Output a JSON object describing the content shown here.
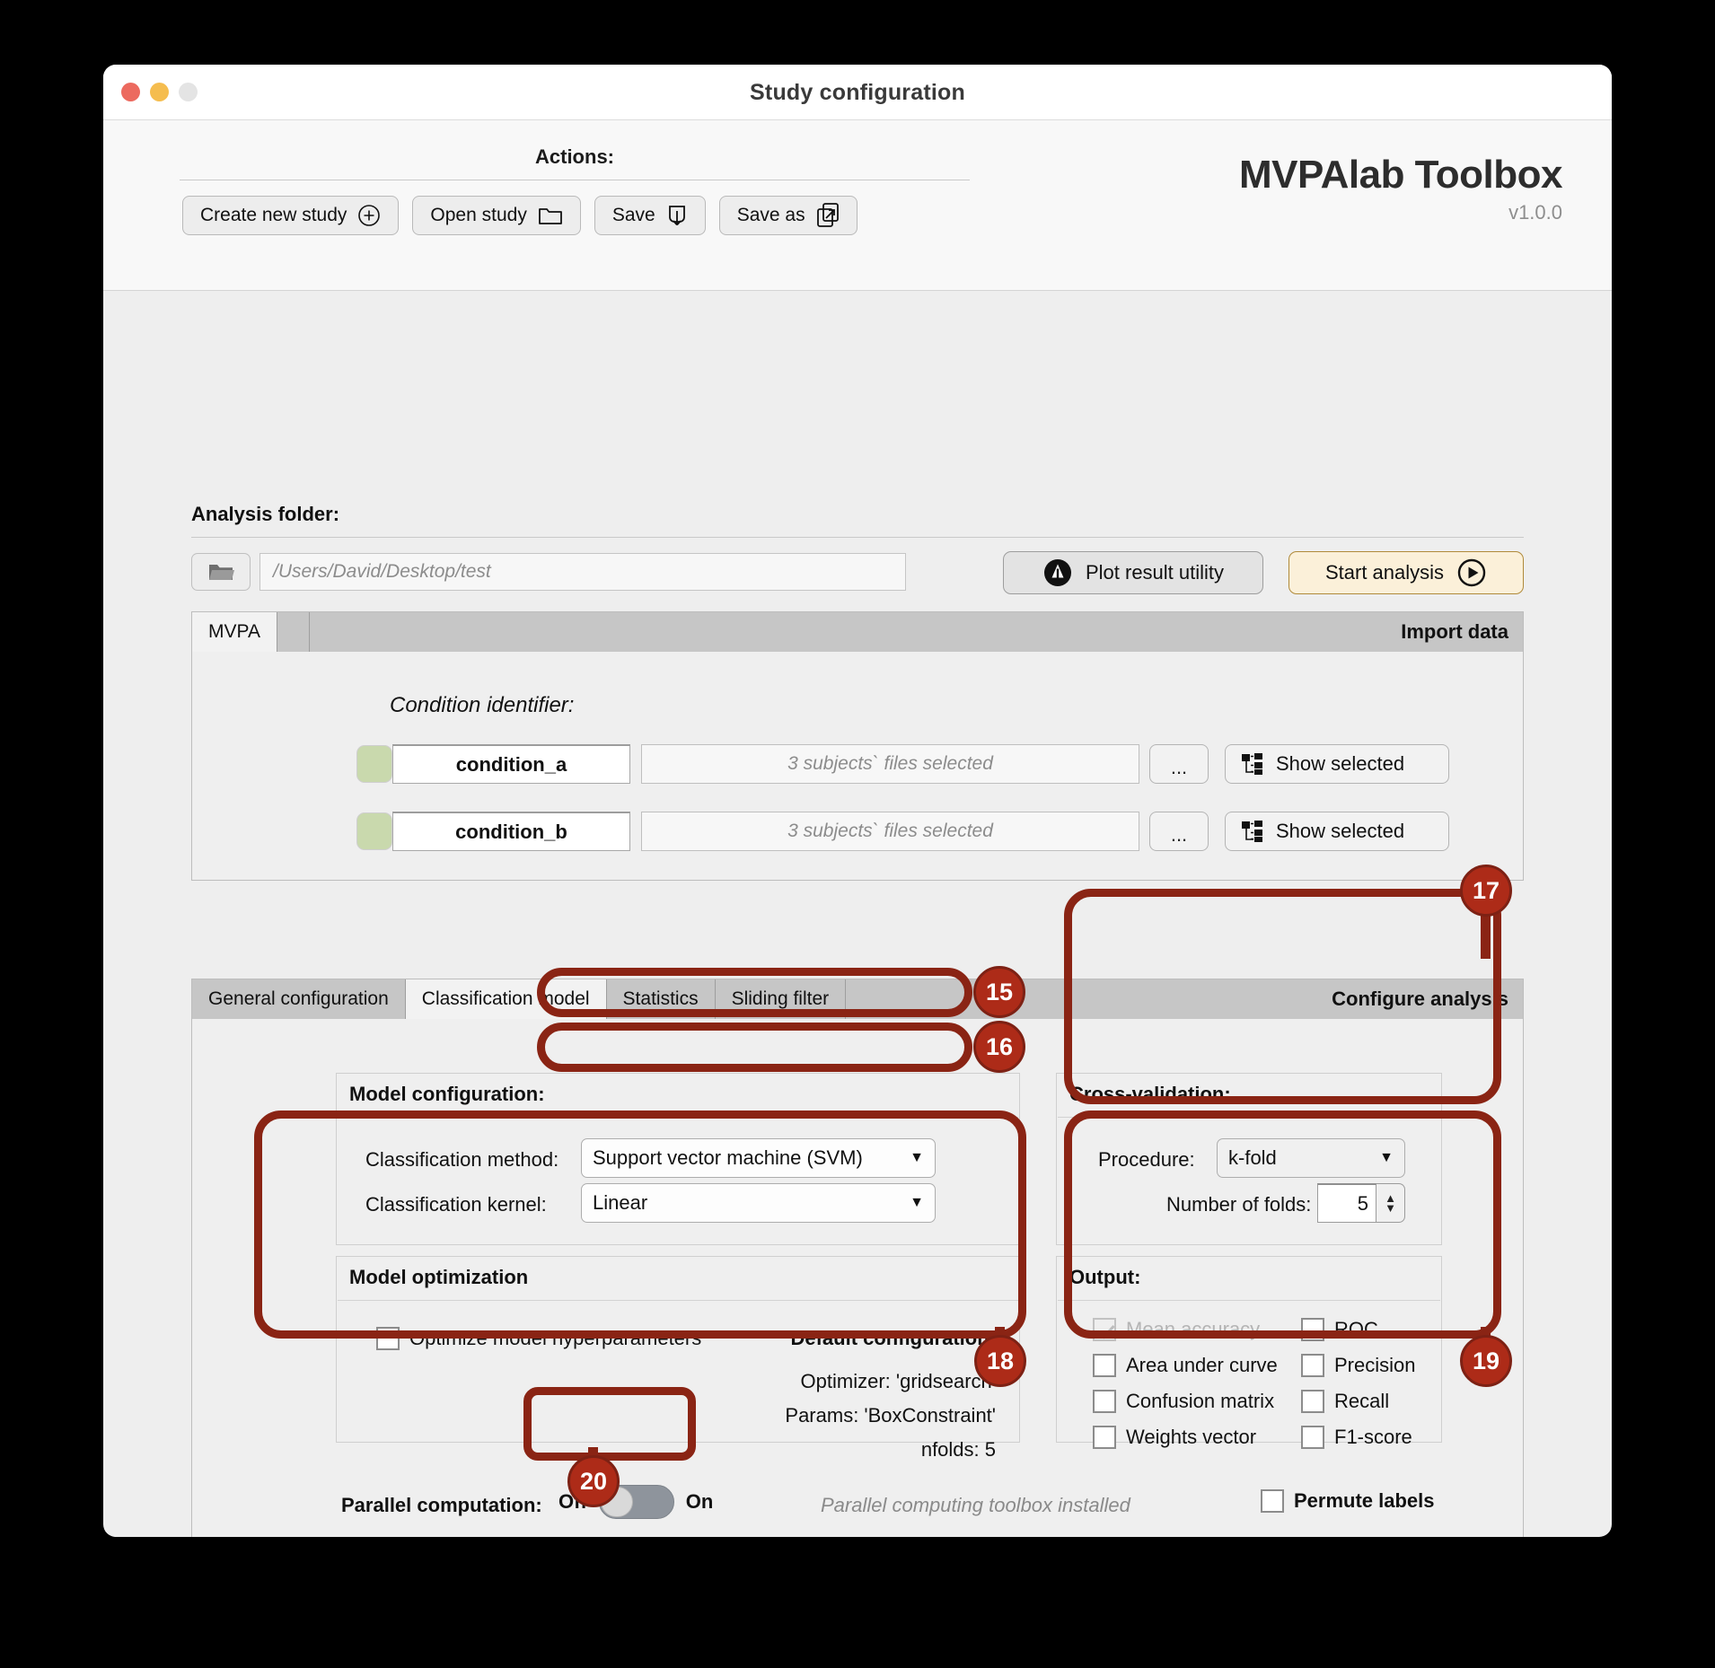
{
  "window": {
    "title": "Study configuration",
    "traffic_lights": [
      "close-red",
      "minimize-yellow",
      "zoom-gray"
    ]
  },
  "header": {
    "actions_label": "Actions:",
    "buttons": [
      {
        "label": "Create new study",
        "icon": "plus-circle-icon"
      },
      {
        "label": "Open study",
        "icon": "folder-icon"
      },
      {
        "label": "Save",
        "icon": "save-download-icon"
      },
      {
        "label": "Save as",
        "icon": "save-as-icon"
      }
    ],
    "brand_name": "MVPAlab Toolbox",
    "brand_version": "v1.0.0"
  },
  "analysis_folder": {
    "label": "Analysis folder:",
    "path_value": "/Users/David/Desktop/test",
    "browse_icon": "folder-open-icon",
    "plot_button": "Plot result utility",
    "plot_icon": "bell-icon",
    "start_button": "Start analysis",
    "start_icon": "play-circle-icon"
  },
  "import_panel": {
    "tabs": [
      {
        "label": "MVPA",
        "active": true
      }
    ],
    "header_right": "Import data",
    "condition_title": "Condition identifier:",
    "rows": [
      {
        "swatch_color": "#c9d9ad",
        "name": "condition_a",
        "files": "3 subjects` files selected",
        "browse": "...",
        "show": "Show selected"
      },
      {
        "swatch_color": "#c9d9ad",
        "name": "condition_b",
        "files": "3 subjects` files selected",
        "browse": "...",
        "show": "Show selected"
      }
    ]
  },
  "config_panel": {
    "tabs": [
      {
        "label": "General configuration",
        "active": false
      },
      {
        "label": "Classification model",
        "active": true
      },
      {
        "label": "Statistics",
        "active": false
      },
      {
        "label": "Sliding filter",
        "active": false
      }
    ],
    "header_right": "Configure analysis",
    "model_configuration": {
      "title": "Model configuration:",
      "method_label": "Classification method:",
      "method_value": "Support vector machine (SVM)",
      "kernel_label": "Classification kernel:",
      "kernel_value": "Linear"
    },
    "cross_validation": {
      "title": "Cross-validation:",
      "procedure_label": "Procedure:",
      "procedure_value": "k-fold",
      "folds_label": "Number of folds:",
      "folds_value": "5"
    },
    "model_optimization": {
      "title": "Model optimization",
      "optimize_label": "Optimize model hyperparameters",
      "optimize_checked": false,
      "default_title": "Default configuration:",
      "default_lines": [
        "Optimizer: 'gridsearch'",
        "Params: 'BoxConstraint'",
        "nfolds: 5"
      ]
    },
    "output": {
      "title": "Output:",
      "left_column": [
        {
          "label": "Mean accuracy",
          "checked": true,
          "disabled": true
        },
        {
          "label": "Area under curve",
          "checked": false,
          "disabled": false
        },
        {
          "label": "Confusion matrix",
          "checked": false,
          "disabled": false
        },
        {
          "label": "Weights vector",
          "checked": false,
          "disabled": false
        }
      ],
      "right_column": [
        {
          "label": "ROC",
          "checked": false,
          "disabled": false
        },
        {
          "label": "Precision",
          "checked": false,
          "disabled": false
        },
        {
          "label": "Recall",
          "checked": false,
          "disabled": false
        },
        {
          "label": "F1-score",
          "checked": false,
          "disabled": false
        }
      ]
    },
    "footer": {
      "parallel_label": "Parallel computation:",
      "toggle_off": "Off",
      "toggle_on": "On",
      "toggle_state": "Off",
      "parallel_note": "Parallel computing toolbox installed",
      "permute_label": "Permute labels",
      "permute_checked": false
    }
  },
  "annotations": {
    "accent_color": "#8a2414",
    "badge_color": "#ad2b18",
    "badges": [
      {
        "number": "15",
        "target": "classification-method-dropdown"
      },
      {
        "number": "16",
        "target": "classification-kernel-dropdown"
      },
      {
        "number": "17",
        "target": "cross-validation-group"
      },
      {
        "number": "18",
        "target": "model-optimization-group"
      },
      {
        "number": "19",
        "target": "output-group"
      },
      {
        "number": "20",
        "target": "parallel-computation-toggle"
      }
    ]
  }
}
